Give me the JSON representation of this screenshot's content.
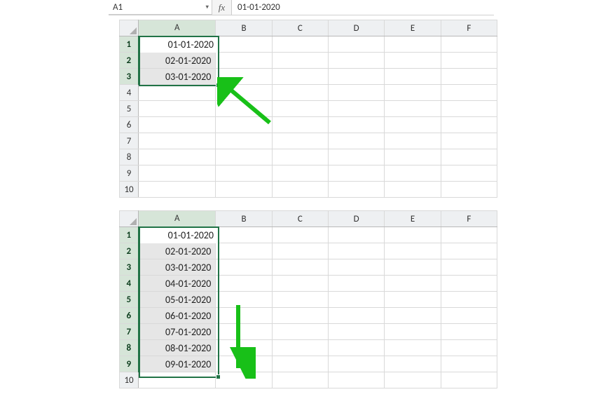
{
  "formula_bar": {
    "name_box": "A1",
    "fx_label": "fx",
    "formula_value": "01-01-2020"
  },
  "columns": [
    "A",
    "B",
    "C",
    "D",
    "E",
    "F"
  ],
  "rows10": [
    "1",
    "2",
    "3",
    "4",
    "5",
    "6",
    "7",
    "8",
    "9",
    "10"
  ],
  "grid1": {
    "selected_rows": [
      1,
      2,
      3
    ],
    "active_value": "01-01-2020",
    "cells": {
      "A1": "01-01-2020",
      "A2": "02-01-2020",
      "A3": "03-01-2020"
    }
  },
  "grid2": {
    "selected_rows": [
      1,
      2,
      3,
      4,
      5,
      6,
      7,
      8,
      9
    ],
    "active_value": "01-01-2020",
    "cells": {
      "A1": "01-01-2020",
      "A2": "02-01-2020",
      "A3": "03-01-2020",
      "A4": "04-01-2020",
      "A5": "05-01-2020",
      "A6": "06-01-2020",
      "A7": "07-01-2020",
      "A8": "08-01-2020",
      "A9": "09-01-2020"
    }
  }
}
